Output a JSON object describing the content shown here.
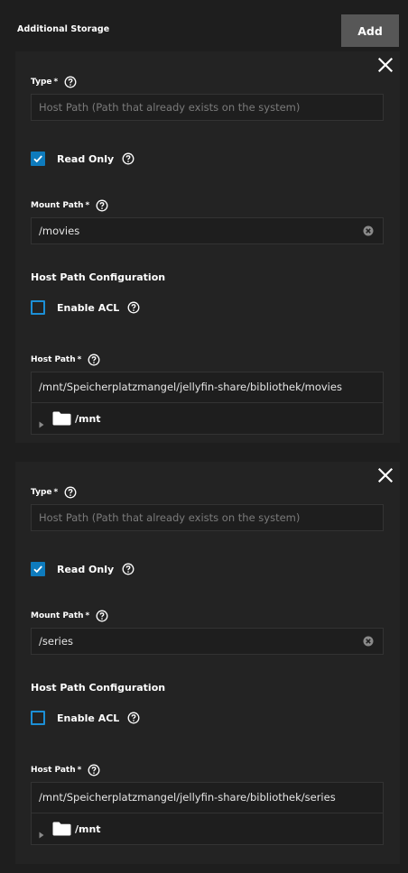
{
  "section": {
    "title": "Additional Storage",
    "add_label": "Add"
  },
  "colors": {
    "accent": "#0e7bbd",
    "background": "#1e1e1e",
    "card": "#232323",
    "add_button": "#575757"
  },
  "cards": [
    {
      "type_label": "Type",
      "type_required": "*",
      "type_value": "Host Path (Path that already exists on the system)",
      "read_only_label": "Read Only",
      "read_only_checked": true,
      "mount_label": "Mount Path",
      "mount_required": "*",
      "mount_value": "/movies",
      "host_config_heading": "Host Path Configuration",
      "acl_label": "Enable ACL",
      "acl_checked": false,
      "host_path_label": "Host Path",
      "host_path_required": "*",
      "host_path_value": "/mnt/Speicherplatzmangel/jellyfin-share/bibliothek/movies",
      "tree_node": "/mnt"
    },
    {
      "type_label": "Type",
      "type_required": "*",
      "type_value": "Host Path (Path that already exists on the system)",
      "read_only_label": "Read Only",
      "read_only_checked": true,
      "mount_label": "Mount Path",
      "mount_required": "*",
      "mount_value": "/series",
      "host_config_heading": "Host Path Configuration",
      "acl_label": "Enable ACL",
      "acl_checked": false,
      "host_path_label": "Host Path",
      "host_path_required": "*",
      "host_path_value": "/mnt/Speicherplatzmangel/jellyfin-share/bibliothek/series",
      "tree_node": "/mnt"
    }
  ],
  "icons": {
    "close": "close-icon",
    "help": "help-circle-icon",
    "clear": "clear-circle-icon",
    "checkbox": "check-icon",
    "tree_arrow": "triangle-right-icon",
    "folder": "folder-icon"
  }
}
